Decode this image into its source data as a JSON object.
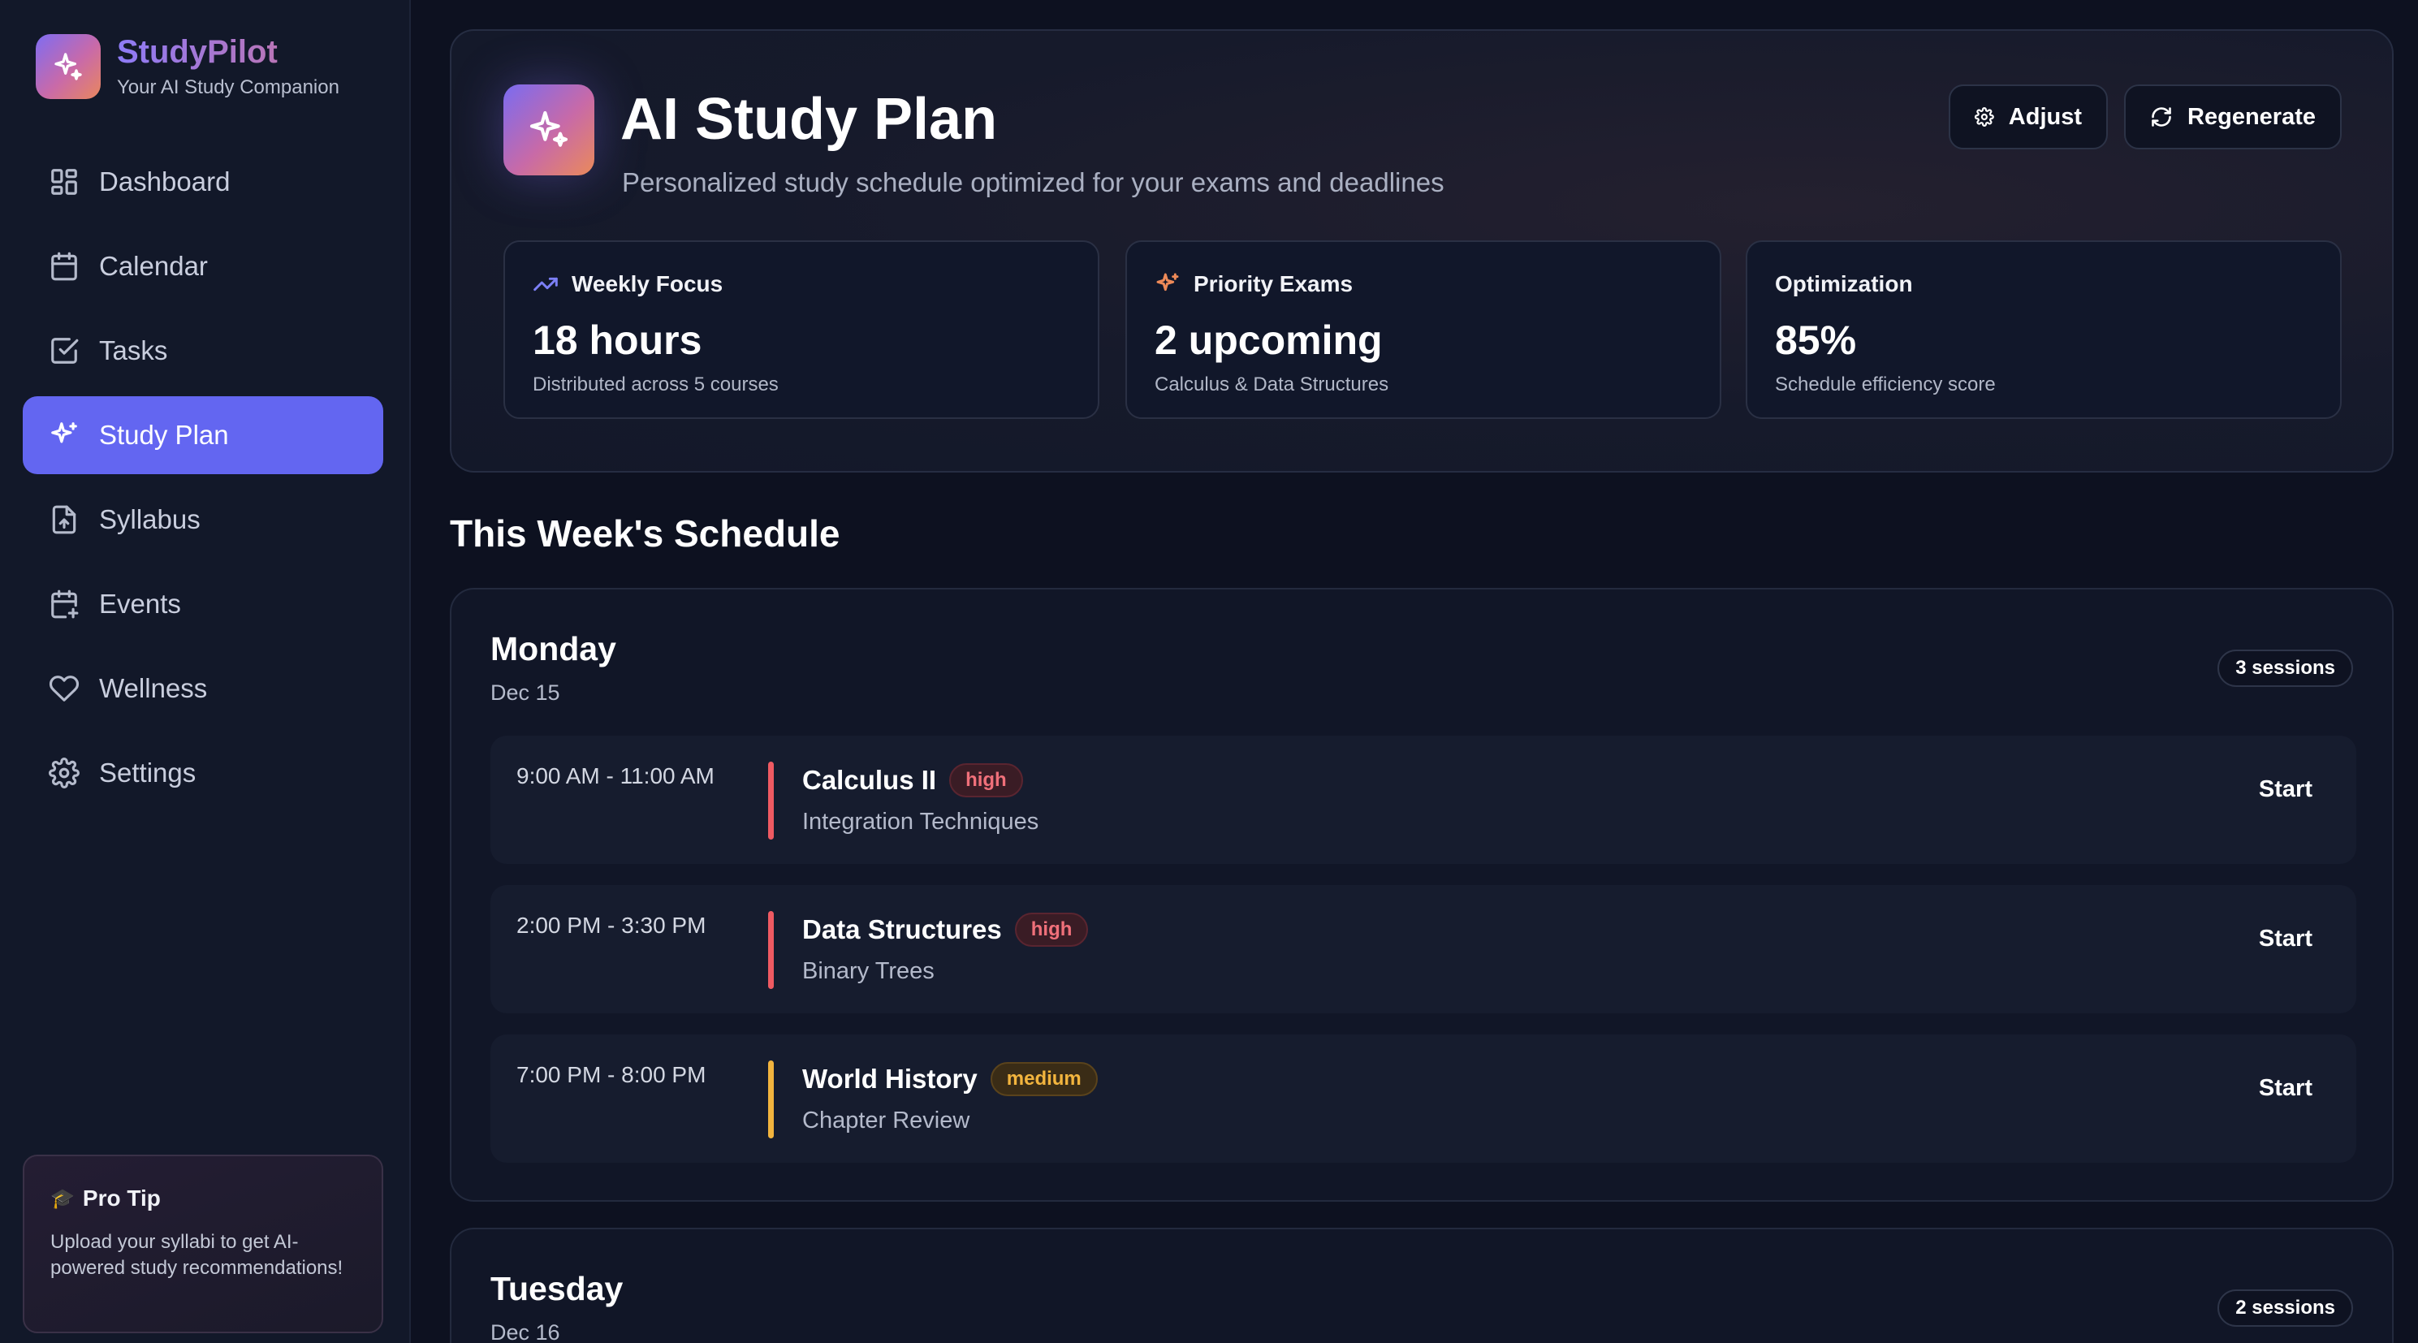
{
  "brand": {
    "name": "StudyPilot",
    "tagline": "Your AI Study Companion"
  },
  "sidebar": {
    "items": [
      {
        "label": "Dashboard",
        "icon": "dashboard-icon"
      },
      {
        "label": "Calendar",
        "icon": "calendar-icon"
      },
      {
        "label": "Tasks",
        "icon": "tasks-icon"
      },
      {
        "label": "Study Plan",
        "icon": "sparkles-icon",
        "active": true
      },
      {
        "label": "Syllabus",
        "icon": "file-upload-icon"
      },
      {
        "label": "Events",
        "icon": "calendar-plus-icon"
      },
      {
        "label": "Wellness",
        "icon": "heart-icon"
      },
      {
        "label": "Settings",
        "icon": "gear-icon"
      }
    ],
    "tip": {
      "title": "Pro Tip",
      "body": "Upload your syllabi to get AI-powered study recommendations!"
    }
  },
  "header": {
    "title": "AI Study Plan",
    "subtitle": "Personalized study schedule optimized for your exams and deadlines",
    "adjust_label": "Adjust",
    "regenerate_label": "Regenerate"
  },
  "stats": [
    {
      "label": "Weekly Focus",
      "value": "18 hours",
      "note": "Distributed across 5 courses",
      "icon": "trending-up-icon"
    },
    {
      "label": "Priority Exams",
      "value": "2 upcoming",
      "note": "Calculus & Data Structures",
      "icon": "sparkles-icon"
    },
    {
      "label": "Optimization",
      "value": "85%",
      "note": "Schedule efficiency score"
    }
  ],
  "schedule": {
    "title": "This Week's Schedule",
    "days": [
      {
        "name": "Monday",
        "date": "Dec 15",
        "sessions_label": "3 sessions",
        "sessions": [
          {
            "time": "9:00 AM - 11:00 AM",
            "course": "Calculus II",
            "priority": "high",
            "topic": "Integration Techniques",
            "action": "Start"
          },
          {
            "time": "2:00 PM - 3:30 PM",
            "course": "Data Structures",
            "priority": "high",
            "topic": "Binary Trees",
            "action": "Start"
          },
          {
            "time": "7:00 PM - 8:00 PM",
            "course": "World History",
            "priority": "medium",
            "topic": "Chapter Review",
            "action": "Start"
          }
        ]
      },
      {
        "name": "Tuesday",
        "date": "Dec 16",
        "sessions_label": "2 sessions"
      }
    ]
  },
  "colors": {
    "accent": "#6366f1",
    "priority_high": "#ef5a62",
    "priority_medium": "#f2b43e"
  }
}
